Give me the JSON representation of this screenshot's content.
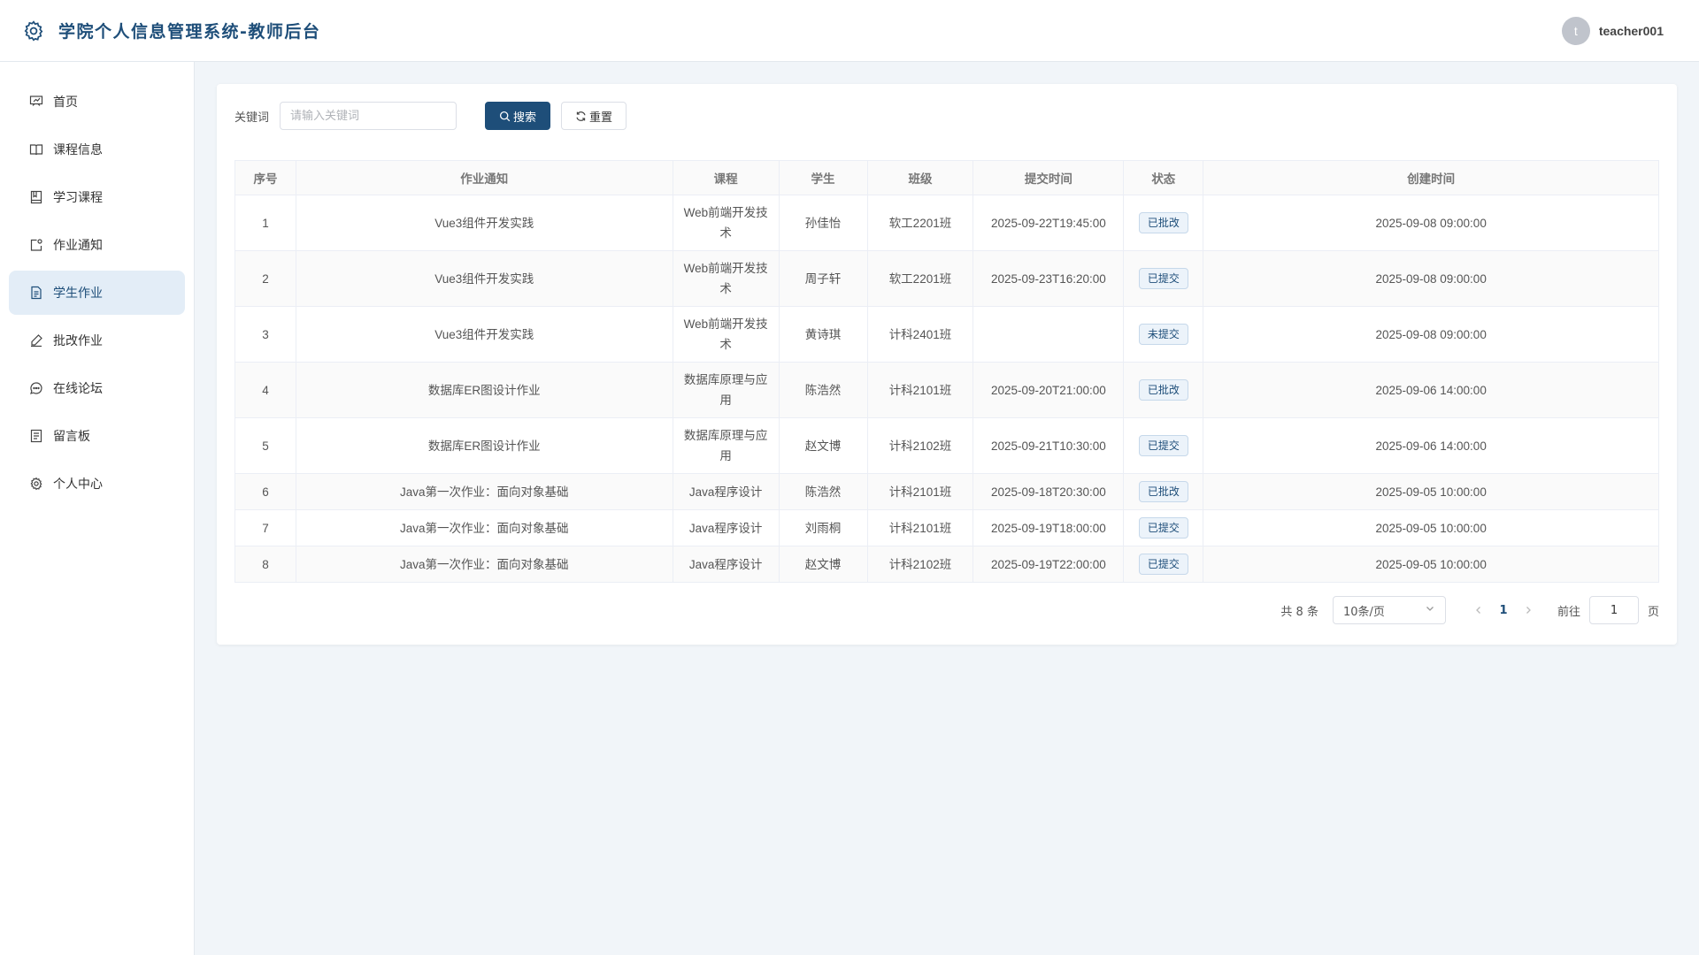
{
  "header": {
    "title": "学院个人信息管理系统-教师后台",
    "logo_icon": "gear-icon",
    "user": {
      "avatar_letter": "t",
      "username": "teacher001"
    }
  },
  "sidebar": {
    "items": [
      {
        "label": "首页",
        "icon": "presentation-board-icon",
        "active": false
      },
      {
        "label": "课程信息",
        "icon": "open-book-icon",
        "active": false
      },
      {
        "label": "学习课程",
        "icon": "notebook-icon",
        "active": false
      },
      {
        "label": "作业通知",
        "icon": "notice-edit-icon",
        "active": false
      },
      {
        "label": "学生作业",
        "icon": "document-icon",
        "active": true
      },
      {
        "label": "批改作业",
        "icon": "pen-icon",
        "active": false
      },
      {
        "label": "在线论坛",
        "icon": "chat-bubble-icon",
        "active": false
      },
      {
        "label": "留言板",
        "icon": "memo-icon",
        "active": false
      },
      {
        "label": "个人中心",
        "icon": "gear-icon",
        "active": false
      }
    ]
  },
  "search": {
    "label": "关键词",
    "placeholder": "请输入关键词",
    "value": "",
    "search_button": "搜索",
    "reset_button": "重置"
  },
  "table": {
    "columns": [
      "序号",
      "作业通知",
      "课程",
      "学生",
      "班级",
      "提交时间",
      "状态",
      "创建时间"
    ],
    "rows": [
      {
        "no": "1",
        "notice": "Vue3组件开发实践",
        "course": "Web前端开发技术",
        "student": "孙佳怡",
        "class": "软工2201班",
        "submitted": "2025-09-22T19:45:00",
        "status": "已批改",
        "created": "2025-09-08 09:00:00"
      },
      {
        "no": "2",
        "notice": "Vue3组件开发实践",
        "course": "Web前端开发技术",
        "student": "周子轩",
        "class": "软工2201班",
        "submitted": "2025-09-23T16:20:00",
        "status": "已提交",
        "created": "2025-09-08 09:00:00"
      },
      {
        "no": "3",
        "notice": "Vue3组件开发实践",
        "course": "Web前端开发技术",
        "student": "黄诗琪",
        "class": "计科2401班",
        "submitted": "",
        "status": "未提交",
        "created": "2025-09-08 09:00:00"
      },
      {
        "no": "4",
        "notice": "数据库ER图设计作业",
        "course": "数据库原理与应用",
        "student": "陈浩然",
        "class": "计科2101班",
        "submitted": "2025-09-20T21:00:00",
        "status": "已批改",
        "created": "2025-09-06 14:00:00"
      },
      {
        "no": "5",
        "notice": "数据库ER图设计作业",
        "course": "数据库原理与应用",
        "student": "赵文博",
        "class": "计科2102班",
        "submitted": "2025-09-21T10:30:00",
        "status": "已提交",
        "created": "2025-09-06 14:00:00"
      },
      {
        "no": "6",
        "notice": "Java第一次作业：面向对象基础",
        "course": "Java程序设计",
        "student": "陈浩然",
        "class": "计科2101班",
        "submitted": "2025-09-18T20:30:00",
        "status": "已批改",
        "created": "2025-09-05 10:00:00"
      },
      {
        "no": "7",
        "notice": "Java第一次作业：面向对象基础",
        "course": "Java程序设计",
        "student": "刘雨桐",
        "class": "计科2101班",
        "submitted": "2025-09-19T18:00:00",
        "status": "已提交",
        "created": "2025-09-05 10:00:00"
      },
      {
        "no": "8",
        "notice": "Java第一次作业：面向对象基础",
        "course": "Java程序设计",
        "student": "赵文博",
        "class": "计科2102班",
        "submitted": "2025-09-19T22:00:00",
        "status": "已提交",
        "created": "2025-09-05 10:00:00"
      }
    ]
  },
  "pagination": {
    "total_text": "共 8 条",
    "page_size": "10条/页",
    "current_page": "1",
    "goto_label": "前往",
    "goto_value": "1",
    "page_suffix": "页"
  },
  "colors": {
    "brand": "#1e4e79",
    "active_bg": "#e3edf7",
    "page_bg": "#f1f5f9"
  }
}
